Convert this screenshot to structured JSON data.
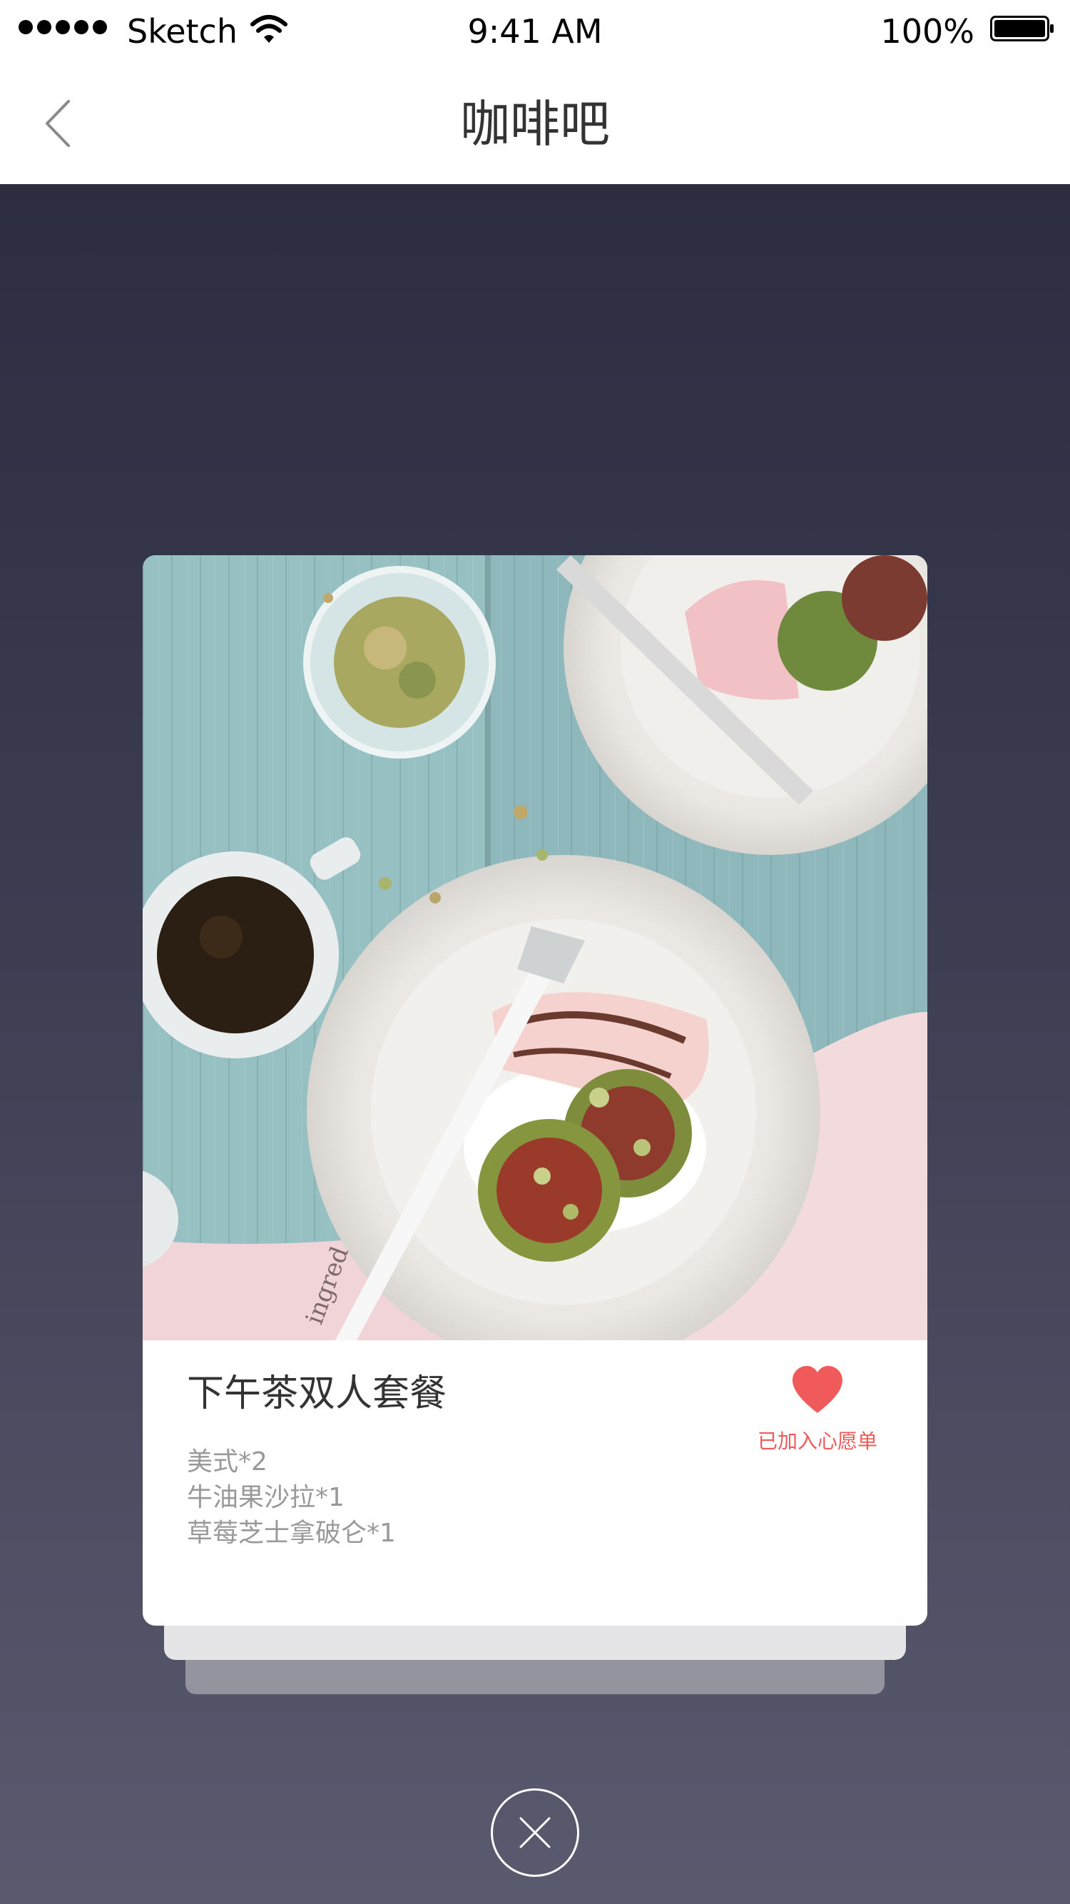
{
  "status_bar": {
    "carrier": "Sketch",
    "time": "9:41 AM",
    "battery": "100%"
  },
  "nav": {
    "title": "咖啡吧",
    "back_icon": "chevron-left-icon"
  },
  "card": {
    "image": "afternoon-tea-dish-photo",
    "title": "下午茶双人套餐",
    "items": [
      "美式*2",
      "牛油果沙拉*1",
      "草莓芝士拿破仑*1"
    ],
    "wishlist": {
      "label": "已加入心愿单",
      "icon": "heart-icon",
      "color": "#f05a5a"
    }
  },
  "close": {
    "icon": "close-icon"
  },
  "colors": {
    "overlay_top": "#2d2d40",
    "overlay_bottom": "#5a5a6f",
    "accent": "#f05a5a"
  }
}
